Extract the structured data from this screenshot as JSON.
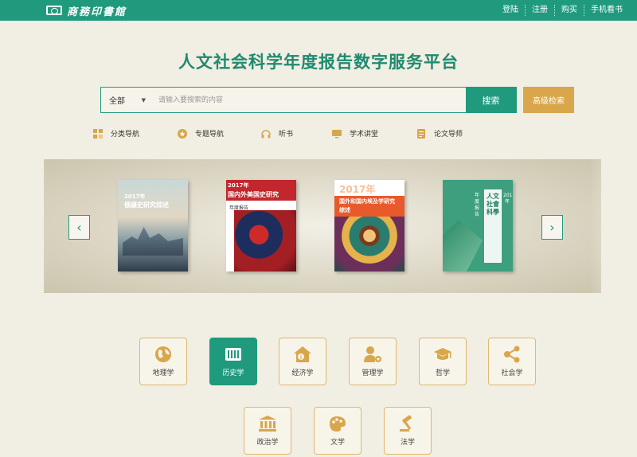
{
  "header": {
    "logo_text": "商務印書館",
    "links": [
      "登陆",
      "注册",
      "购买",
      "手机看书"
    ]
  },
  "title": "人文社会科学年度报告数字服务平台",
  "search": {
    "scope": "全部",
    "placeholder": "请输入要搜索的内容",
    "button": "搜索",
    "advanced": "高级检索"
  },
  "nav": [
    {
      "label": "分类导航",
      "icon": "grid-icon"
    },
    {
      "label": "专题导航",
      "icon": "star-icon"
    },
    {
      "label": "听书",
      "icon": "headphone-icon"
    },
    {
      "label": "学术讲堂",
      "icon": "screen-icon"
    },
    {
      "label": "论文导师",
      "icon": "document-icon"
    }
  ],
  "books": [
    {
      "year": "2017年",
      "title": "俄疆史研究综述"
    },
    {
      "year": "2017年",
      "title": "国内外美国史研究",
      "sub": "年度报告"
    },
    {
      "year": "2017年",
      "title": "国外和国内埃及学研究综述"
    },
    {
      "title": "人文社會科學",
      "side": "年度报告",
      "year": "2017年"
    }
  ],
  "subjects_row1": [
    {
      "label": "地理学",
      "icon": "globe-icon",
      "active": false
    },
    {
      "label": "历史学",
      "icon": "history-icon",
      "active": true
    },
    {
      "label": "经济学",
      "icon": "house-money-icon",
      "active": false
    },
    {
      "label": "管理学",
      "icon": "person-gear-icon",
      "active": false
    },
    {
      "label": "哲学",
      "icon": "graduation-cap-icon",
      "active": false
    },
    {
      "label": "社会学",
      "icon": "network-icon",
      "active": false
    }
  ],
  "subjects_row2": [
    {
      "label": "政治学",
      "icon": "government-icon",
      "active": false
    },
    {
      "label": "文学",
      "icon": "palette-icon",
      "active": false
    },
    {
      "label": "法学",
      "icon": "gavel-icon",
      "active": false
    }
  ],
  "colors": {
    "primary": "#1f9a7d",
    "gold": "#d9a64c",
    "icon_gold": "#d9a64c"
  }
}
